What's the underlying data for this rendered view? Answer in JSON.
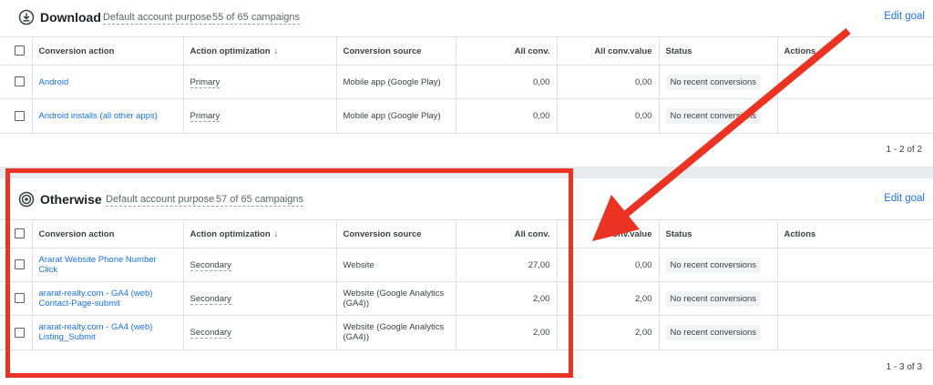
{
  "sections": [
    {
      "title": "Download",
      "icon": "download-icon",
      "purpose": "Default account purpose",
      "campaigns": "55 of 65 campaigns",
      "edit_goal": "Edit goal",
      "columns": {
        "action": "Conversion action",
        "optimization": "Action optimization",
        "source": "Conversion source",
        "all_conv": "All conv.",
        "all_conv_value": "All conv.value",
        "status": "Status",
        "actions": "Actions"
      },
      "rows": [
        {
          "action": "Android",
          "optimization": "Primary",
          "source": "Mobile app (Google Play)",
          "all_conv": "0,00",
          "all_conv_value": "0,00",
          "status": "No recent conversions"
        },
        {
          "action": "Android installs (all other apps)",
          "optimization": "Primary",
          "source": "Mobile app (Google Play)",
          "all_conv": "0,00",
          "all_conv_value": "0,00",
          "status": "No recent conversions"
        }
      ],
      "pagination": "1 - 2 of 2"
    },
    {
      "title": "Otherwise",
      "icon": "target-icon",
      "purpose": "Default account purpose",
      "campaigns": "57 of 65 campaigns",
      "edit_goal": "Edit goal",
      "columns": {
        "action": "Conversion action",
        "optimization": "Action optimization",
        "source": "Conversion source",
        "all_conv": "All conv.",
        "all_conv_value": "All conv.value",
        "status": "Status",
        "actions": "Actions"
      },
      "rows": [
        {
          "action": "Ararat Website Phone Number Click",
          "optimization": "Secondary",
          "source": "Website",
          "all_conv": "27,00",
          "all_conv_value": "0,00",
          "status": "No recent conversions"
        },
        {
          "action": "ararat-realty.com - GA4 (web) Contact-Page-submit",
          "optimization": "Secondary",
          "source": "Website (Google Analytics (GA4))",
          "all_conv": "2,00",
          "all_conv_value": "2,00",
          "status": "No recent conversions"
        },
        {
          "action": "ararat-realty.com - GA4 (web) Listing_Submit",
          "optimization": "Secondary",
          "source": "Website (Google Analytics (GA4))",
          "all_conv": "2,00",
          "all_conv_value": "2,00",
          "status": "No recent conversions"
        }
      ],
      "pagination": "1 - 3 of 3"
    }
  ],
  "annotation": {
    "box_color": "#ea3323",
    "arrow_color": "#ea3323"
  },
  "colors": {
    "link": "#1a73e8",
    "divider": "#e8eaed"
  }
}
